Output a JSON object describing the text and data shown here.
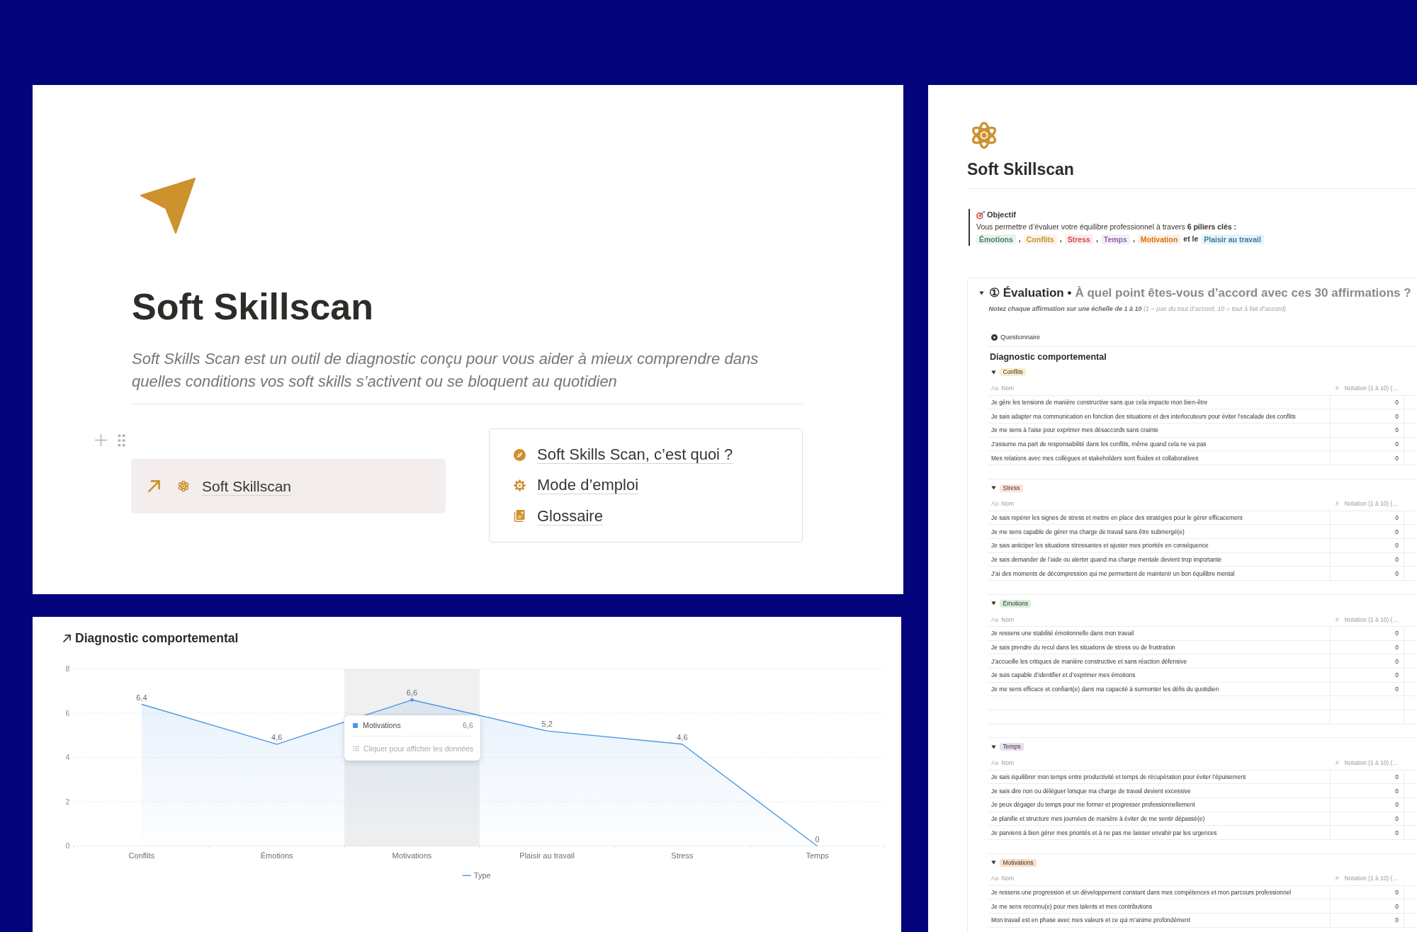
{
  "home_page": {
    "title": "Soft Skillscan",
    "description": "Soft Skills Scan est un outil de diagnostic conçu pour vous aider à mieux comprendre dans quelles conditions vos soft skills s’activent ou se bloquent au quotidien",
    "link_block": {
      "label": "Soft Skillscan"
    },
    "menu": [
      {
        "kind": "intro",
        "label": "Soft Skills Scan, c’est quoi ?"
      },
      {
        "kind": "guide",
        "label": "Mode d’emploi"
      },
      {
        "kind": "glossary",
        "label": "Glossaire"
      }
    ]
  },
  "chart_panel": {
    "chart_data": {
      "type": "area",
      "title": "Diagnostic comportemental",
      "categories": [
        "Conflits",
        "Émotions",
        "Motivations",
        "Plaisir au travail",
        "Stress",
        "Temps"
      ],
      "series": [
        {
          "name": "Type",
          "color": "#4b97e6",
          "values": [
            6.4,
            4.6,
            6.6,
            5.2,
            4.6,
            0
          ]
        }
      ],
      "ylim": [
        0,
        8
      ],
      "yticks": [
        0,
        2,
        4,
        6,
        8
      ],
      "grid": true,
      "value_labels": [
        "6,4",
        "4,6",
        "6,6",
        "5,2",
        "4,6",
        "0"
      ]
    },
    "highlights": [
      {
        "selected": false
      },
      {
        "selected": false
      },
      {
        "selected": true
      },
      {
        "selected": false
      },
      {
        "selected": false
      },
      {
        "selected": false
      }
    ],
    "tooltip": {
      "label": "Motivations",
      "value": "6,6",
      "hint": "Cliquer pour afficher les données"
    }
  },
  "detail_page": {
    "title": "Soft Skillscan",
    "callout": {
      "heading": "Objectif",
      "text": "Vous permettre d’évaluer votre équilibre professionnel à travers **6 piliers clés :**",
      "pillars": [
        {
          "label": "Émotions",
          "color": "#448361",
          "separator": ","
        },
        {
          "label": "Conflits",
          "color": "#cb912f",
          "separator": ","
        },
        {
          "label": "Stress",
          "color": "#d44c47",
          "separator": ","
        },
        {
          "label": "Temps",
          "color": "#9065b0",
          "separator": ","
        },
        {
          "label": "Motivation",
          "color": "#d9730d",
          "separator": "et le"
        },
        {
          "label": "Plaisir au travail",
          "color": "#337ea9"
        }
      ]
    },
    "evaluation": {
      "expanded": true,
      "heading": "① Évaluation •",
      "question": "À quel point êtes-vous d’accord avec ces 30 affirmations ?",
      "instructions": "**Notez chaque affirmation sur une échelle de 1 à 10** (1 = pas du tout d’accord, 10 = tout à fait d’accord)",
      "button": "Questionnaire",
      "database_title": "Diagnostic comportemental",
      "groups": [
        {
          "label": "Conflits",
          "color": "#fdecc8",
          "expanded": true,
          "columns": [
            {
              "kind": "text",
              "icon": "Aa",
              "label": "Nom"
            },
            {
              "kind": "number",
              "icon": "#",
              "label": "Notation (1 à 10) (…"
            }
          ],
          "rows": [
            {
              "kind": "entry",
              "statement": "Je gère les tensions de manière constructive sans que cela impacte mon bien-être",
              "score": "0"
            },
            {
              "kind": "entry",
              "statement": "Je sais adapter ma communication en fonction des situations et des interlocuteurs pour éviter l’escalade des conflits",
              "score": "0"
            },
            {
              "kind": "entry",
              "statement": "Je me sens à l’aise pour exprimer mes désaccords sans crainte",
              "score": "0"
            },
            {
              "kind": "entry",
              "statement": "J’assume ma part de responsabilité dans les conflits, même quand cela ne va pas",
              "score": "0"
            },
            {
              "kind": "entry",
              "statement": "Mes relations avec mes collègues et stakeholders sont fluides et collaboratives",
              "score": "0"
            }
          ]
        },
        {
          "label": "Stress",
          "color": "#ffe2dd",
          "expanded": true,
          "columns": [
            {
              "kind": "text",
              "icon": "Aa",
              "label": "Nom"
            },
            {
              "kind": "number",
              "icon": "#",
              "label": "Notation (1 à 10) (…"
            }
          ],
          "rows": [
            {
              "kind": "entry",
              "statement": "Je sais repérer les signes de stress et mettre en place des stratégies pour le gérer efficacement",
              "score": "0"
            },
            {
              "kind": "entry",
              "statement": "Je me sens capable de gérer ma charge de travail sans être submergé(e)",
              "score": "0"
            },
            {
              "kind": "entry",
              "statement": "Je sais anticiper les situations stressantes et ajuster mes priorités en conséquence",
              "score": "0"
            },
            {
              "kind": "entry",
              "statement": "Je sais demander de l’aide ou alerter quand ma charge mentale devient trop importante",
              "score": "0"
            },
            {
              "kind": "entry",
              "statement": "J’ai des moments de décompression qui me permettent de maintenir un bon équilibre mental",
              "score": "0"
            }
          ]
        },
        {
          "label": "Émotions",
          "color": "#dbeddb",
          "expanded": true,
          "columns": [
            {
              "kind": "text",
              "icon": "Aa",
              "label": "Nom"
            },
            {
              "kind": "number",
              "icon": "#",
              "label": "Notation (1 à 10) (…"
            }
          ],
          "rows": [
            {
              "kind": "entry",
              "statement": "Je ressens une stabilité émotionnelle dans mon travail",
              "score": "0"
            },
            {
              "kind": "entry",
              "statement": "Je sais prendre du recul dans les situations de stress ou de frustration",
              "score": "0"
            },
            {
              "kind": "entry",
              "statement": "J’accueille les critiques de manière constructive et sans réaction défensive",
              "score": "0"
            },
            {
              "kind": "entry",
              "statement": "Je suis capable d’identifier et d’exprimer mes émotions",
              "score": "0"
            },
            {
              "kind": "entry",
              "statement": "Je me sens efficace et confiant(e) dans ma capacité à surmonter les défis du quotidien",
              "score": "0"
            },
            {
              "kind": "empty"
            },
            {
              "kind": "empty"
            }
          ]
        },
        {
          "label": "Temps",
          "color": "#e8deee",
          "expanded": true,
          "columns": [
            {
              "kind": "text",
              "icon": "Aa",
              "label": "Nom"
            },
            {
              "kind": "number",
              "icon": "#",
              "label": "Notation (1 à 10) (…"
            }
          ],
          "rows": [
            {
              "kind": "entry",
              "statement": "Je sais équilibrer mon temps entre productivité et temps de récupération pour éviter l’épuisement",
              "score": "0"
            },
            {
              "kind": "entry",
              "statement": "Je sais dire non ou déléguer lorsque ma charge de travail devient excessive",
              "score": "0"
            },
            {
              "kind": "entry",
              "statement": "Je peux dégager du temps pour me former et progresser professionnellement",
              "score": "0"
            },
            {
              "kind": "entry",
              "statement": "Je planifie et structure mes journées de manière à éviter de me sentir dépassé(e)",
              "score": "0"
            },
            {
              "kind": "entry",
              "statement": "Je parviens à bien gérer mes priorités et à ne pas me laisser envahir par les urgences",
              "score": "0"
            }
          ]
        },
        {
          "label": "Motivations",
          "color": "#fadec9",
          "expanded": true,
          "columns": [
            {
              "kind": "text",
              "icon": "Aa",
              "label": "Nom"
            },
            {
              "kind": "number",
              "icon": "#",
              "label": "Notation (1 à 10) (…"
            }
          ],
          "rows": [
            {
              "kind": "entry",
              "statement": "Je ressens une progression et un développement constant dans mes compétences et mon parcours professionnel",
              "score": "0"
            },
            {
              "kind": "entry",
              "statement": "Je me sens reconnu(e) pour mes talents et mes contributions",
              "score": "0"
            },
            {
              "kind": "entry",
              "statement": "Mon travail est en phase avec mes valeurs et ce qui m’anime profondément",
              "score": "0"
            }
          ]
        }
      ]
    }
  }
}
